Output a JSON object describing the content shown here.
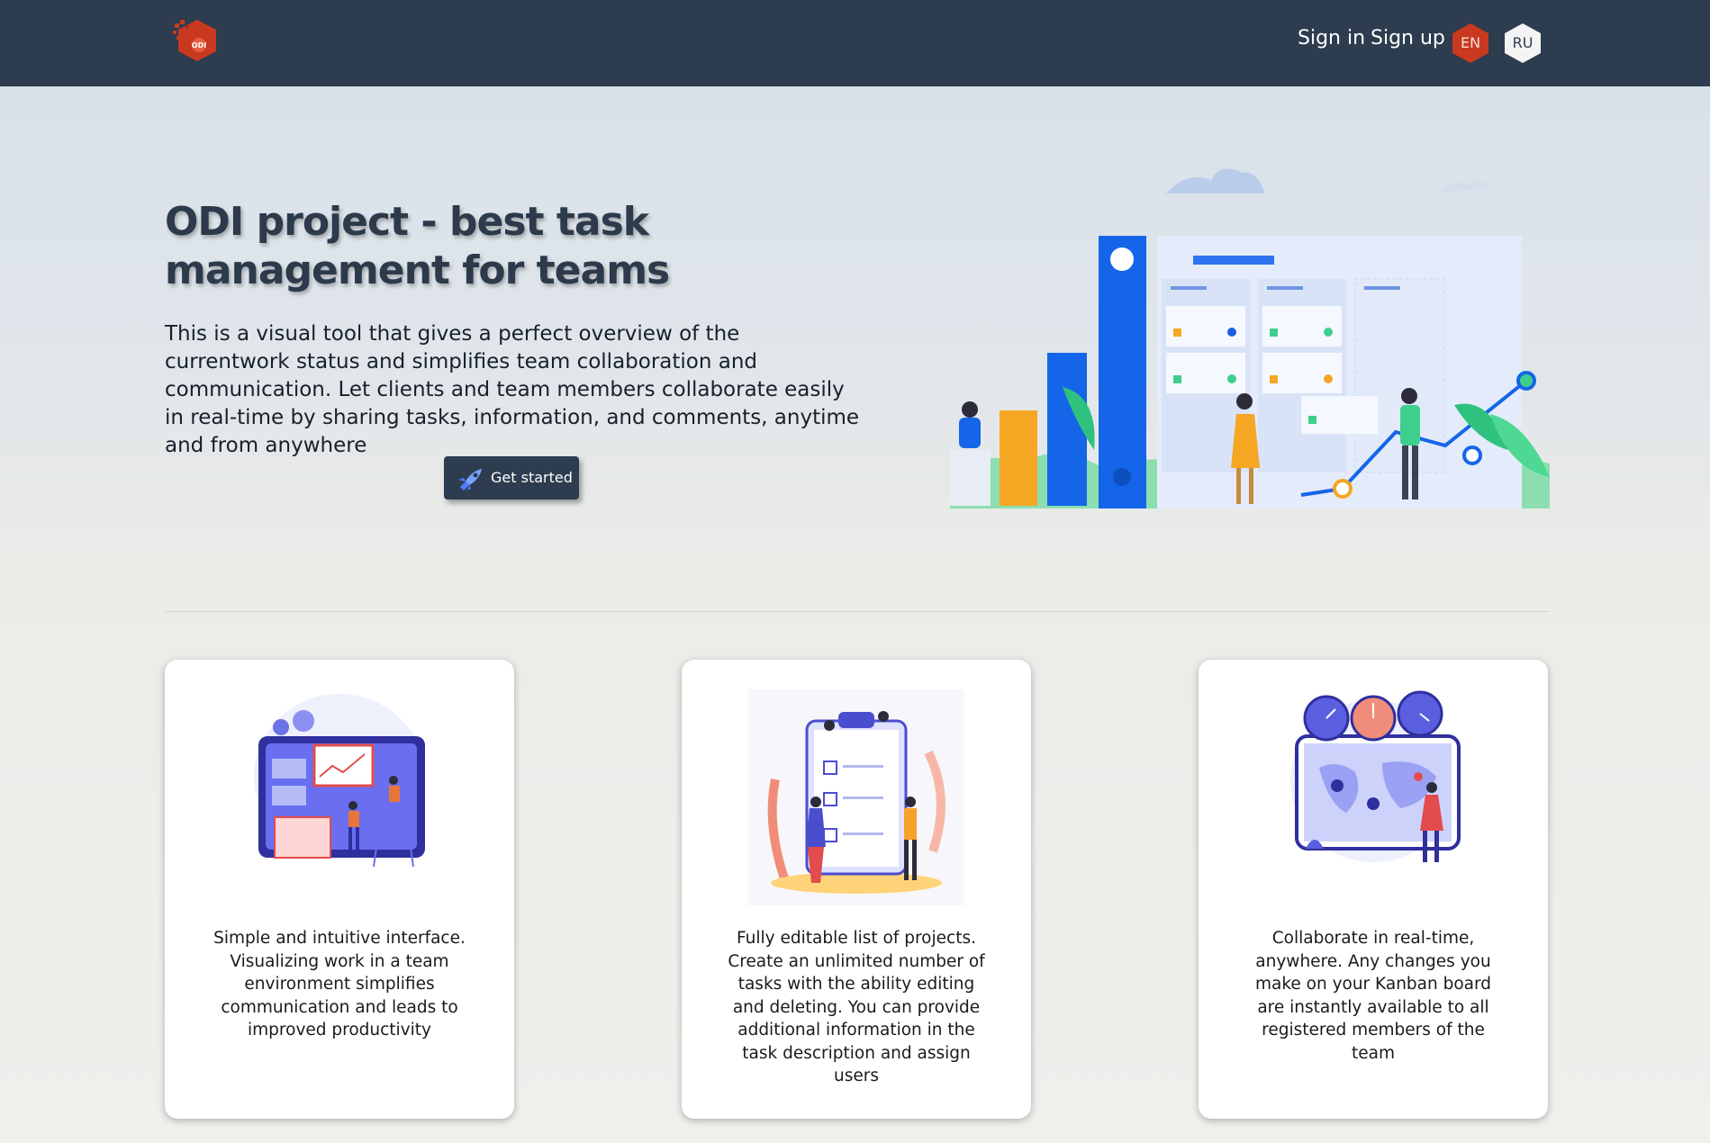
{
  "header": {
    "logo_text": "ODI",
    "sign_in": "Sign in",
    "sign_up": "Sign up",
    "languages": [
      {
        "code": "EN",
        "active": true
      },
      {
        "code": "RU",
        "active": false
      }
    ]
  },
  "hero": {
    "title": "ODI project - best task management for teams",
    "description": "This is a visual tool that gives a perfect overview of the currentwork status and simplifies team collaboration and communication. Let clients and team members collaborate easily in real-time by sharing tasks, information, and comments, anytime and from anywhere",
    "cta_label": "Get started"
  },
  "features": [
    {
      "text": "Simple and intuitive interface. Visualizing work in a team environment simplifies communication and leads to improved productivity"
    },
    {
      "text": "Fully editable list of projects. Create an unlimited number of tasks with the ability editing and deleting. You can provide additional information in the task description and assign users"
    },
    {
      "text": "Collaborate in real-time, anywhere. Any changes you make on your Kanban board are instantly available to all registered members of the team"
    }
  ],
  "colors": {
    "header_bg": "#2d3c4f",
    "brand_red": "#c8391f",
    "primary_blue": "#1565e8"
  }
}
